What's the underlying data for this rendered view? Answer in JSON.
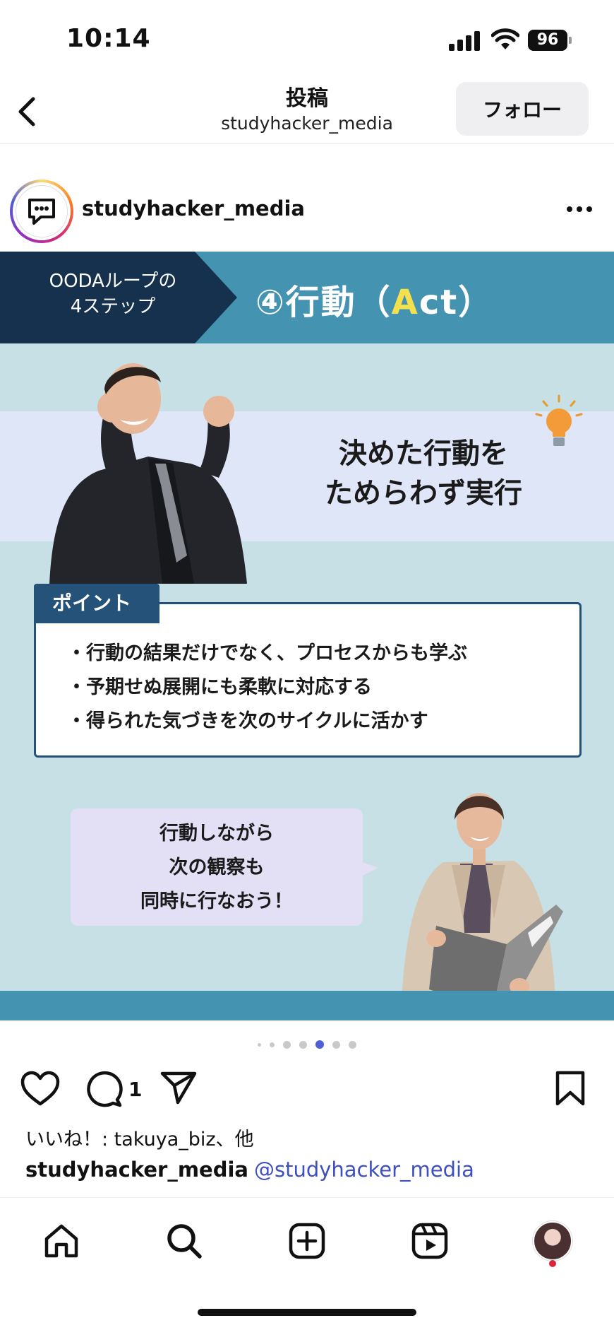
{
  "status_bar": {
    "time": "10:14",
    "battery": "96"
  },
  "header": {
    "title": "投稿",
    "subtitle": "studyhacker_media",
    "follow_label": "フォロー"
  },
  "post": {
    "username": "studyhacker_media",
    "image": {
      "step_label_line1": "OODAループの",
      "step_label_line2": "4ステップ",
      "step_title_prefix": "④行動（",
      "step_title_a": "A",
      "step_title_rest": "ct）",
      "headline_line1": "決めた行動を",
      "headline_line2": "ためらわず実行",
      "point_tab": "ポイント",
      "points": [
        "・行動の結果だけでなく、プロセスからも学ぶ",
        "・予期せぬ展開にも柔軟に対応する",
        "・得られた気づきを次のサイクルに活かす"
      ],
      "bubble_lines": [
        "行動しながら",
        "次の観察も",
        "同時に行なおう！"
      ],
      "colors": {
        "band": "#4493b0",
        "dark_band": "#15314d",
        "background": "#c6e0e6",
        "accent_yellow": "#f4e04d",
        "point_blue": "#245279",
        "bubble": "#e3dff5"
      }
    },
    "carousel": {
      "total": 7,
      "active_index": 4
    },
    "comment_count": "1",
    "likes_text": "いいね！: takuya_biz、他",
    "caption_user": "studyhacker_media",
    "caption_mention": "@studyhacker_media"
  },
  "icons": {
    "back": "chevron-left-icon",
    "more": "more-dots-icon",
    "like": "heart-icon",
    "comment": "comment-icon",
    "share": "send-icon",
    "save": "bookmark-icon",
    "home": "home-icon",
    "search": "search-icon",
    "create": "plus-square-icon",
    "reels": "reels-icon"
  },
  "accent_colors": {
    "mention": "#3e4fbf",
    "notification": "#e0243a",
    "active_dot": "#4f5fd6"
  }
}
